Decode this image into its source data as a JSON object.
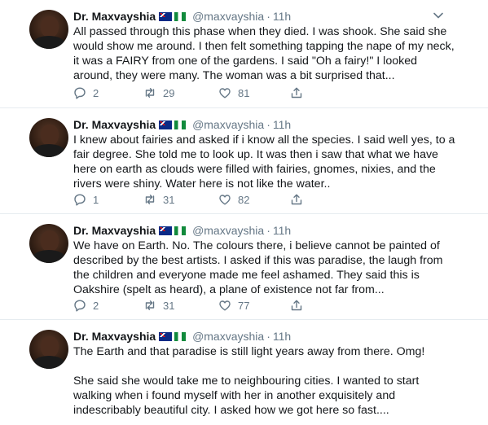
{
  "tweets": [
    {
      "name": "Dr. Maxvayshia",
      "handle": "@maxvayshia",
      "time": "11h",
      "text": [
        "All passed through this phase when they died. I was shook. She said she would show me around. I then felt something tapping the nape of my neck, it was a FAIRY from one of the gardens. I said \"Oh a fairy!\" I looked around, they were many. The woman was a bit surprised that..."
      ],
      "replies": "2",
      "retweets": "29",
      "likes": "81"
    },
    {
      "name": "Dr. Maxvayshia",
      "handle": "@maxvayshia",
      "time": "11h",
      "text": [
        "I knew about fairies and asked if i know all the species. I said well yes, to a fair degree. She told me to look up. It was then i saw that what we have here on earth as clouds were filled with fairies, gnomes, nixies, and the rivers were shiny. Water here is not like the water.."
      ],
      "replies": "1",
      "retweets": "31",
      "likes": "82"
    },
    {
      "name": "Dr. Maxvayshia",
      "handle": "@maxvayshia",
      "time": "11h",
      "text": [
        "We have on Earth. No. The colours there, i believe cannot be painted of described by the best artists. I asked if this was paradise, the laugh from the children and everyone made me feel ashamed. They said this is Oakshire (spelt as heard), a plane of existence not far from..."
      ],
      "replies": "2",
      "retweets": "31",
      "likes": "77"
    },
    {
      "name": "Dr. Maxvayshia",
      "handle": "@maxvayshia",
      "time": "11h",
      "text": [
        "The Earth and that paradise is still light years away from there. Omg!",
        "She said she would take me to neighbouring cities. I wanted to start walking when i found myself with her in another exquisitely and indescribably beautiful city. I asked how we got here so fast...."
      ]
    }
  ],
  "icons": {
    "reply": "reply-icon",
    "retweet": "retweet-icon",
    "like": "heart-icon",
    "share": "share-icon",
    "caret": "chevron-down-icon"
  },
  "colors": {
    "text": "#14171a",
    "muted": "#657786",
    "divider": "#e6ecf0"
  }
}
